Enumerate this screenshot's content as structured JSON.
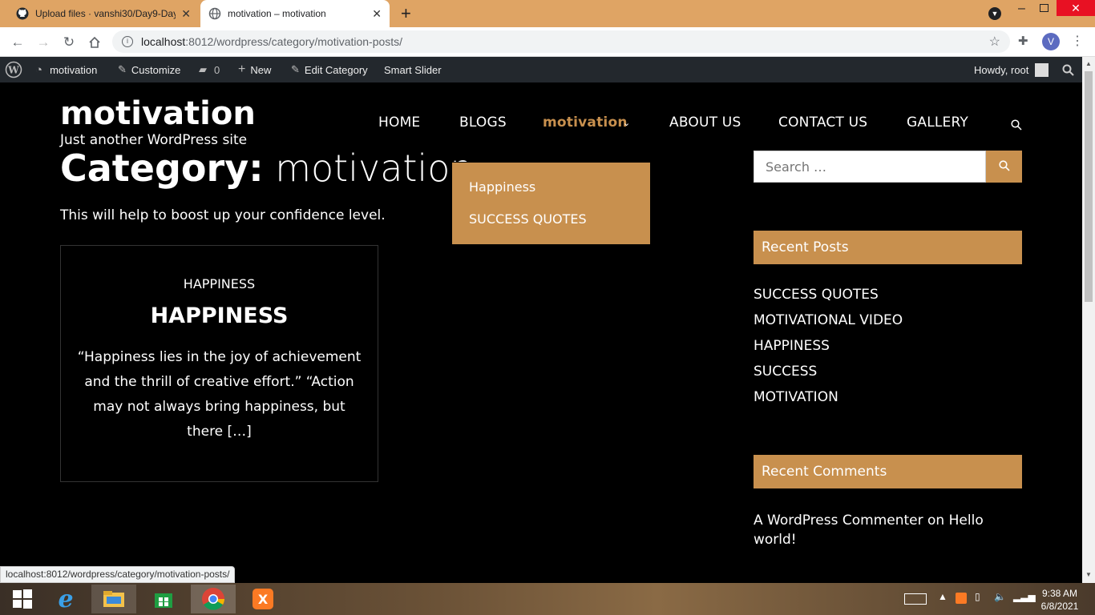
{
  "browser": {
    "tabs": [
      {
        "title": "Upload files · vanshi30/Day9-Day",
        "icon": "github-icon"
      },
      {
        "title": "motivation – motivation",
        "icon": "globe-icon"
      }
    ],
    "new_tab_label": "+",
    "url_host": "localhost",
    "url_rest": ":8012/wordpress/category/motivation-posts/",
    "profile_initial": "V"
  },
  "adminbar": {
    "site": "motivation",
    "customize": "Customize",
    "comments": "0",
    "new": "New",
    "edit_category": "Edit Category",
    "smart_slider": "Smart Slider",
    "howdy": "Howdy, root"
  },
  "site": {
    "title": "motivation",
    "tagline": "Just another WordPress site"
  },
  "nav": {
    "items": [
      "HOME",
      "BLOGS",
      "motivation",
      "ABOUT US",
      "CONTACT US",
      "GALLERY"
    ],
    "dropdown": [
      "Happiness",
      "SUCCESS QUOTES"
    ]
  },
  "archive": {
    "prefix": "Category:",
    "name": "motivation",
    "description": "This will help to boost up your confidence level."
  },
  "post": {
    "category": "HAPPINESS",
    "title": "HAPPINESS",
    "excerpt_lines": [
      "“Happiness lies in the joy of achievement",
      "and the thrill of creative effort.” “Action",
      "may not always bring happiness, but",
      "there […]"
    ]
  },
  "sidebar": {
    "search_placeholder": "Search …",
    "recent_posts_title": "Recent Posts",
    "recent_posts": [
      "SUCCESS QUOTES",
      "MOTIVATIONAL VIDEO",
      "HAPPINESS",
      "SUCCESS",
      "MOTIVATION"
    ],
    "recent_comments_title": "Recent Comments",
    "comment_author": "A WordPress Commenter",
    "comment_on": "on",
    "comment_post_line1": "Hello",
    "comment_post_line2": "world!"
  },
  "status_url": "localhost:8012/wordpress/category/motivation-posts/",
  "taskbar": {
    "time": "9:38 AM",
    "date": "6/8/2021"
  },
  "colors": {
    "accent": "#c8904e",
    "tabbar": "#dfa464",
    "adminbar": "#23282d"
  }
}
